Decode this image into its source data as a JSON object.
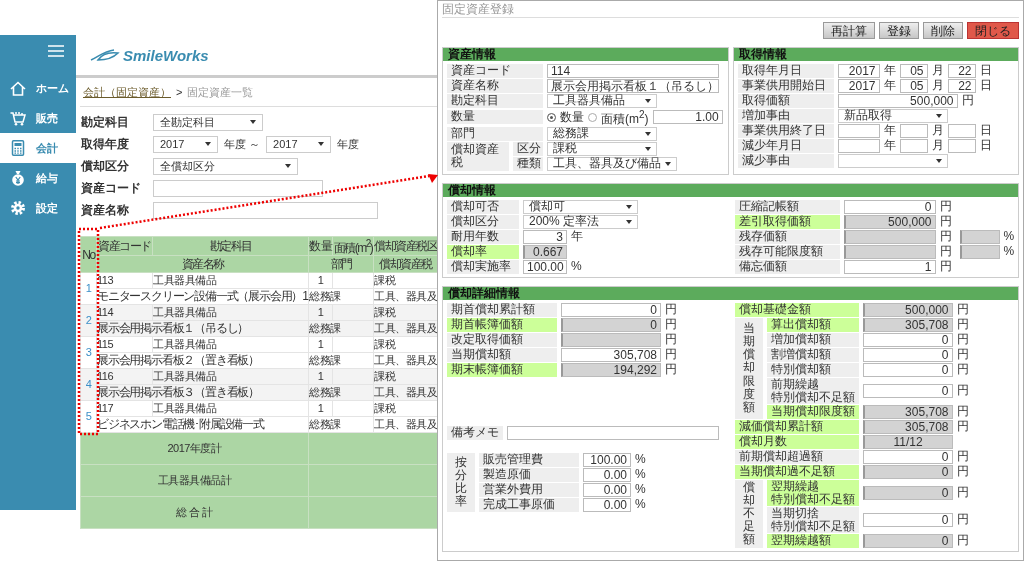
{
  "sidebar": {
    "items": [
      {
        "label": "ホーム",
        "selected": false
      },
      {
        "label": "販売",
        "selected": false
      },
      {
        "label": "会計",
        "selected": true
      },
      {
        "label": "給与",
        "selected": false
      },
      {
        "label": "設定",
        "selected": false
      }
    ]
  },
  "logo": {
    "text": "SmileWorks"
  },
  "breadcrumb": {
    "link": "会計（固定資産）",
    "separator": ">",
    "current": "固定資産一覧"
  },
  "filters": [
    {
      "kind": "select",
      "label": "勘定科目",
      "value": "全勘定科目"
    },
    {
      "kind": "range",
      "label": "取得年度",
      "from": "2017",
      "between": "年度 ～",
      "to": "2017",
      "suffix": "年度"
    },
    {
      "kind": "select",
      "label": "償却区分",
      "value": "全償却区分"
    },
    {
      "kind": "text",
      "label": "資産コード"
    },
    {
      "kind": "text",
      "label": "資産名称"
    }
  ],
  "table": {
    "no_header": "No",
    "header_top": [
      "資産コード",
      "勘定科目",
      "数 量",
      "面積(m$^{2}$)",
      "償却資産税区"
    ],
    "header_bottom": [
      "資産名称",
      "部門",
      "償却資産税"
    ],
    "rows": [
      {
        "no": "1",
        "code": "113",
        "account": "工具器具備品",
        "quantity": "1",
        "tax_class": "課税",
        "name": "モニタースクリーン設備一式（展示会用）1",
        "department": "総務課",
        "tax_type": "工具、器具及"
      },
      {
        "no": "2",
        "code": "114",
        "account": "工具器具備品",
        "quantity": "1",
        "tax_class": "課税",
        "name": "展示会用掲示看板１（吊るし）",
        "department": "総務課",
        "tax_type": "工具、器具及"
      },
      {
        "no": "3",
        "code": "115",
        "account": "工具器具備品",
        "quantity": "1",
        "tax_class": "課税",
        "name": "展示会用掲示看板２（置き看板）",
        "department": "総務課",
        "tax_type": "工具、器具及"
      },
      {
        "no": "4",
        "code": "116",
        "account": "工具器具備品",
        "quantity": "1",
        "tax_class": "課税",
        "name": "展示会用掲示看板３（置き看板）",
        "department": "総務課",
        "tax_type": "工具、器具及"
      },
      {
        "no": "5",
        "code": "117",
        "account": "工具器具備品",
        "quantity": "1",
        "tax_class": "課税",
        "name": "ビジネスホン電話機･附属設備一式",
        "department": "総務課",
        "tax_type": "工具、器具及"
      }
    ],
    "totals": [
      "2017年度計",
      "工具器具備品計",
      "総 合 計"
    ]
  },
  "dialog": {
    "title": "固定資産登録",
    "buttons": [
      {
        "label": "再計算",
        "kind": "default"
      },
      {
        "label": "登録",
        "kind": "default"
      },
      {
        "label": "削除",
        "kind": "default"
      },
      {
        "label": "閉じる",
        "kind": "danger"
      }
    ],
    "asset_info": {
      "title": "資産情報",
      "rows": [
        {
          "kind": "text",
          "label": "資産コード",
          "value": "114"
        },
        {
          "kind": "text",
          "label": "資産名称",
          "value": "展示会用掲示看板１（吊るし）"
        },
        {
          "kind": "select",
          "label": "勘定科目",
          "value": "工具器具備品"
        },
        {
          "kind": "quantity",
          "label": "数量",
          "options": [
            {
              "label": "数量",
              "selected": true
            },
            {
              "label": "面積(m$^{2}$)",
              "selected": false
            }
          ],
          "value": "1.00"
        },
        {
          "kind": "select",
          "label": "部門",
          "value": "総務課"
        },
        {
          "kind": "group",
          "label": "償却資産税",
          "children": [
            {
              "kind": "select",
              "label": "区分",
              "value": "課税"
            },
            {
              "kind": "select",
              "label": "種類",
              "value": "工具、器具及び備品"
            }
          ]
        }
      ]
    },
    "acquisition": {
      "title": "取得情報",
      "rows": [
        {
          "kind": "date",
          "label": "取得年月日",
          "parts": [
            {
              "value": "2017",
              "unit": "年"
            },
            {
              "value": "05",
              "unit": "月"
            },
            {
              "value": "22",
              "unit": "日"
            }
          ]
        },
        {
          "kind": "date",
          "label": "事業供用開始日",
          "parts": [
            {
              "value": "2017",
              "unit": "年"
            },
            {
              "value": "05",
              "unit": "月"
            },
            {
              "value": "22",
              "unit": "日"
            }
          ]
        },
        {
          "kind": "number",
          "label": "取得価額",
          "value": "500,000",
          "unit": "円"
        },
        {
          "kind": "select",
          "label": "増加事由",
          "value": "新品取得"
        },
        {
          "kind": "date",
          "label": "事業供用終了日",
          "parts": [
            {
              "unit": "年"
            },
            {
              "unit": "月"
            },
            {
              "unit": "日"
            }
          ]
        },
        {
          "kind": "date",
          "label": "減少年月日",
          "parts": [
            {
              "unit": "年"
            },
            {
              "unit": "月"
            },
            {
              "unit": "日"
            }
          ]
        },
        {
          "kind": "select",
          "label": "減少事由"
        }
      ]
    },
    "depreciation": {
      "title": "償却情報",
      "left": [
        {
          "kind": "select",
          "label": "償却可否",
          "value": "償却可",
          "highlighted": false,
          "readonly": false
        },
        {
          "kind": "select",
          "label": "償却区分",
          "value": "200% 定率法",
          "highlighted": false,
          "readonly": false
        },
        {
          "kind": "number",
          "label": "耐用年数",
          "value": "3",
          "unit": "年",
          "highlighted": false,
          "readonly": false
        },
        {
          "kind": "number",
          "label": "償却率",
          "value": "0.667",
          "highlighted": true,
          "readonly": true
        },
        {
          "kind": "number",
          "label": "償却実施率",
          "value": "100.00",
          "unit": "%",
          "highlighted": false,
          "readonly": false
        }
      ],
      "right": [
        {
          "kind": "number",
          "label": "圧縮記帳額",
          "value": "0",
          "unit": "円",
          "highlighted": false,
          "readonly": false
        },
        {
          "kind": "number",
          "label": "差引取得価額",
          "value": "500,000",
          "unit": "円",
          "highlighted": true,
          "readonly": true
        },
        {
          "kind": "number",
          "label": "残存価額",
          "unit": "円",
          "highlighted": false,
          "readonly": true,
          "percent_field": {
            "readonly": true,
            "unit": "%"
          }
        },
        {
          "kind": "number",
          "label": "残存可能限度額",
          "unit": "円",
          "highlighted": false,
          "readonly": true,
          "percent_field": {
            "readonly": true,
            "unit": "%"
          }
        },
        {
          "kind": "number",
          "label": "備忘価額",
          "value": "1",
          "unit": "円",
          "highlighted": false,
          "readonly": false
        }
      ]
    },
    "detail": {
      "title": "償却詳細情報",
      "left": [
        {
          "kind": "number",
          "label": "期首償却累計額",
          "value": "0",
          "unit": "円",
          "highlighted": false,
          "readonly": false
        },
        {
          "kind": "number",
          "label": "期首帳簿価額",
          "value": "0",
          "unit": "円",
          "highlighted": true,
          "readonly": true
        },
        {
          "kind": "number",
          "label": "改定取得価額",
          "unit": "円",
          "highlighted": false,
          "readonly": true
        },
        {
          "kind": "number",
          "label": "当期償却額",
          "value": "305,708",
          "unit": "円",
          "highlighted": false,
          "readonly": false
        },
        {
          "kind": "number",
          "label": "期末帳簿価額",
          "value": "194,292",
          "unit": "円",
          "highlighted": true,
          "readonly": true
        }
      ],
      "memo": {
        "label": "備考メモ"
      },
      "allocation": {
        "label": "按分比率",
        "rows": [
          {
            "kind": "number",
            "label": "販売管理費",
            "value": "100.00",
            "unit": "%",
            "highlighted": false,
            "readonly": false
          },
          {
            "kind": "number",
            "label": "製造原価",
            "value": "0.00",
            "unit": "%",
            "highlighted": false,
            "readonly": false
          },
          {
            "kind": "number",
            "label": "営業外費用",
            "value": "0.00",
            "unit": "%",
            "highlighted": false,
            "readonly": false
          },
          {
            "kind": "number",
            "label": "完成工事原価",
            "value": "0.00",
            "unit": "%",
            "highlighted": false,
            "readonly": false
          }
        ]
      },
      "right": [
        {
          "kind": "number",
          "label": "償却基礎金額",
          "value": "500,000",
          "unit": "円",
          "highlighted": true,
          "readonly": true
        },
        {
          "kind": "group",
          "label": "当期償却限度額",
          "children": [
            {
              "kind": "number",
              "label": "算出償却額",
              "value": "305,708",
              "unit": "円",
              "highlighted": true,
              "readonly": true
            },
            {
              "kind": "number",
              "label": "増加償却額",
              "value": "0",
              "unit": "円",
              "highlighted": false,
              "readonly": false
            },
            {
              "kind": "number",
              "label": "割増償却額",
              "value": "0",
              "unit": "円",
              "highlighted": false,
              "readonly": false
            },
            {
              "kind": "number",
              "label": "特別償却額",
              "value": "0",
              "unit": "円",
              "highlighted": false,
              "readonly": false
            },
            {
              "kind": "number",
              "label_lines": [
                "前期繰越",
                "特別償却不足額"
              ],
              "value": "0",
              "unit": "円",
              "highlighted": false,
              "readonly": false
            },
            {
              "kind": "number",
              "label": "当期償却限度額",
              "value": "305,708",
              "unit": "円",
              "highlighted": true,
              "readonly": true
            }
          ]
        },
        {
          "kind": "number",
          "label": "減価償却累計額",
          "value": "305,708",
          "unit": "円",
          "highlighted": true,
          "readonly": true
        },
        {
          "kind": "ratio",
          "label": "償却月数",
          "value": "11/12",
          "highlighted": true,
          "readonly": true
        },
        {
          "kind": "number",
          "label": "前期償却超過額",
          "value": "0",
          "unit": "円",
          "highlighted": false,
          "readonly": false
        },
        {
          "kind": "number",
          "label": "当期償却過不足額",
          "value": "0",
          "unit": "円",
          "highlighted": true,
          "readonly": true
        },
        {
          "kind": "group",
          "label": "償却不足額",
          "children": [
            {
              "kind": "number",
              "label_lines": [
                "翌期繰越",
                "特別償却不足額"
              ],
              "value": "0",
              "unit": "円",
              "highlighted": true,
              "readonly": true
            },
            {
              "kind": "number",
              "label_lines": [
                "当期切捨",
                "特別償却不足額"
              ],
              "value": "0",
              "unit": "円",
              "highlighted": false,
              "readonly": false
            },
            {
              "kind": "number",
              "label": "翌期繰越額",
              "value": "0",
              "unit": "円",
              "highlighted": true,
              "readonly": true
            }
          ]
        }
      ]
    }
  }
}
